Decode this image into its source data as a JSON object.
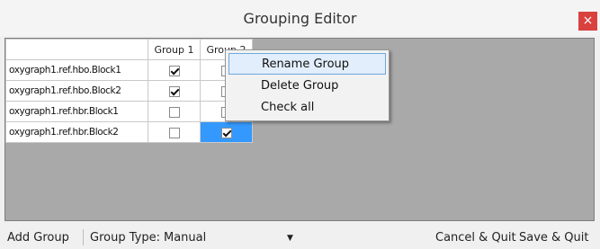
{
  "window": {
    "title": "Grouping Editor",
    "close_glyph": "×"
  },
  "grid": {
    "columns": [
      "Group 1",
      "Group 2"
    ],
    "rows": [
      {
        "label": "oxygraph1.ref.hbo.Block1",
        "checks": [
          true,
          false
        ]
      },
      {
        "label": "oxygraph1.ref.hbo.Block2",
        "checks": [
          true,
          false
        ]
      },
      {
        "label": "oxygraph1.ref.hbr.Block1",
        "checks": [
          false,
          false
        ]
      },
      {
        "label": "oxygraph1.ref.hbr.Block2",
        "checks": [
          false,
          true
        ]
      }
    ],
    "selected_cell": {
      "row": 3,
      "col": 1
    }
  },
  "context_menu": {
    "items": [
      "Rename Group",
      "Delete Group",
      "Check all"
    ],
    "highlighted_index": 0
  },
  "statusbar": {
    "add_group": "Add Group",
    "group_type_label": "Group Type:",
    "group_type_value": "Manual",
    "cancel_quit": "Cancel & Quit",
    "save_quit": "Save & Quit"
  },
  "colors": {
    "selection": "#3399ff",
    "close_button": "#d9413f",
    "grid_background": "#a9a9a9"
  },
  "icons": {
    "close": "close-icon",
    "dropdown": "chevron-down-icon"
  }
}
